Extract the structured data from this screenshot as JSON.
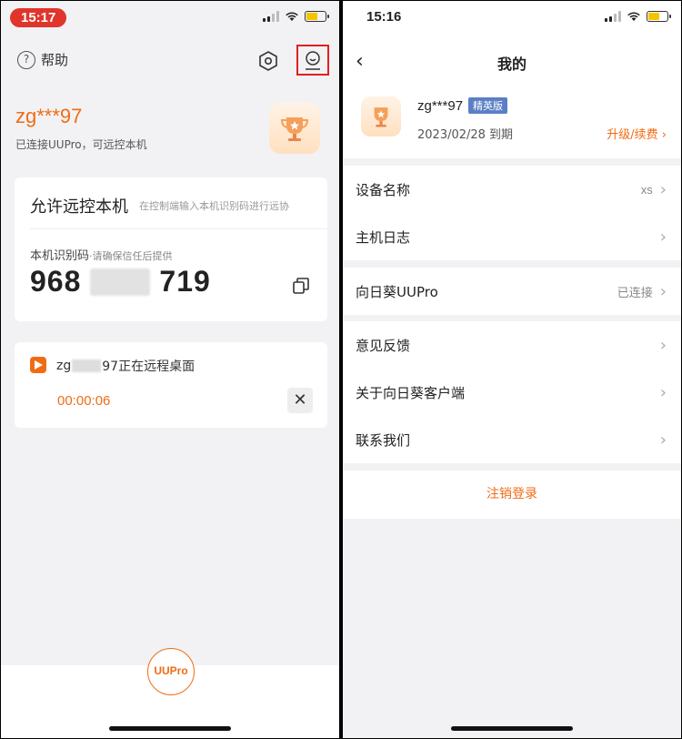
{
  "left": {
    "status_time": "15:17",
    "help_label": "帮助",
    "user_name": "zg***97",
    "connection_status": "已连接UUPro，可远控本机",
    "remote_card": {
      "title": "允许远控本机",
      "hint": "在控制端输入本机识别码进行远协",
      "id_label": "本机识别码",
      "id_hint": "·请确保信任后提供",
      "id_part1": "968",
      "id_part3": "719"
    },
    "session": {
      "prefix": "zg",
      "suffix": "97正在远程桌面",
      "timer": "00:00:06",
      "close_label": "✕"
    },
    "uupro_label": "UUPro"
  },
  "right": {
    "status_time": "15:16",
    "nav_title": "我的",
    "profile": {
      "name": "zg***97",
      "badge": "精英版",
      "expiry": "2023/02/28 到期",
      "upgrade": "升级/续费"
    },
    "groups": [
      {
        "rows": [
          {
            "label": "设备名称",
            "value": "xs"
          },
          {
            "label": "主机日志",
            "value": ""
          }
        ]
      },
      {
        "rows": [
          {
            "label": "向日葵UUPro",
            "value": "已连接"
          }
        ]
      },
      {
        "rows": [
          {
            "label": "意见反馈",
            "value": ""
          },
          {
            "label": "关于向日葵客户端",
            "value": ""
          },
          {
            "label": "联系我们",
            "value": ""
          }
        ]
      }
    ],
    "logout": "注销登录"
  },
  "colors": {
    "accent": "#f06c14",
    "highlight_box": "#e02020",
    "badge": "#5b7fc6"
  },
  "icons": [
    "help-icon",
    "hexagon-settings-icon",
    "face-profile-icon",
    "trophy-icon",
    "copy-icon",
    "remote-app-icon",
    "close-icon",
    "back-chevron-icon",
    "chevron-right-icon"
  ]
}
